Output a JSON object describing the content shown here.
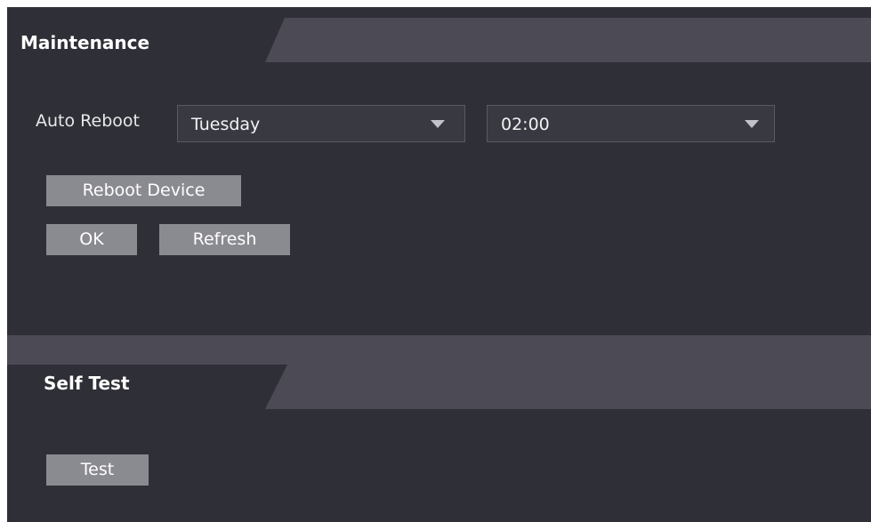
{
  "maintenance": {
    "title": "Maintenance",
    "auto_reboot_label": "Auto Reboot",
    "day_select": {
      "value": "Tuesday"
    },
    "time_select": {
      "value": "02:00"
    },
    "reboot_device_label": "Reboot Device",
    "ok_label": "OK",
    "refresh_label": "Refresh"
  },
  "self_test": {
    "title": "Self Test",
    "test_label": "Test"
  },
  "colors": {
    "panel_bg": "#2f2f37",
    "header_band": "#4c4b55",
    "button_bg": "#8a8a91",
    "select_bg": "#393942"
  }
}
